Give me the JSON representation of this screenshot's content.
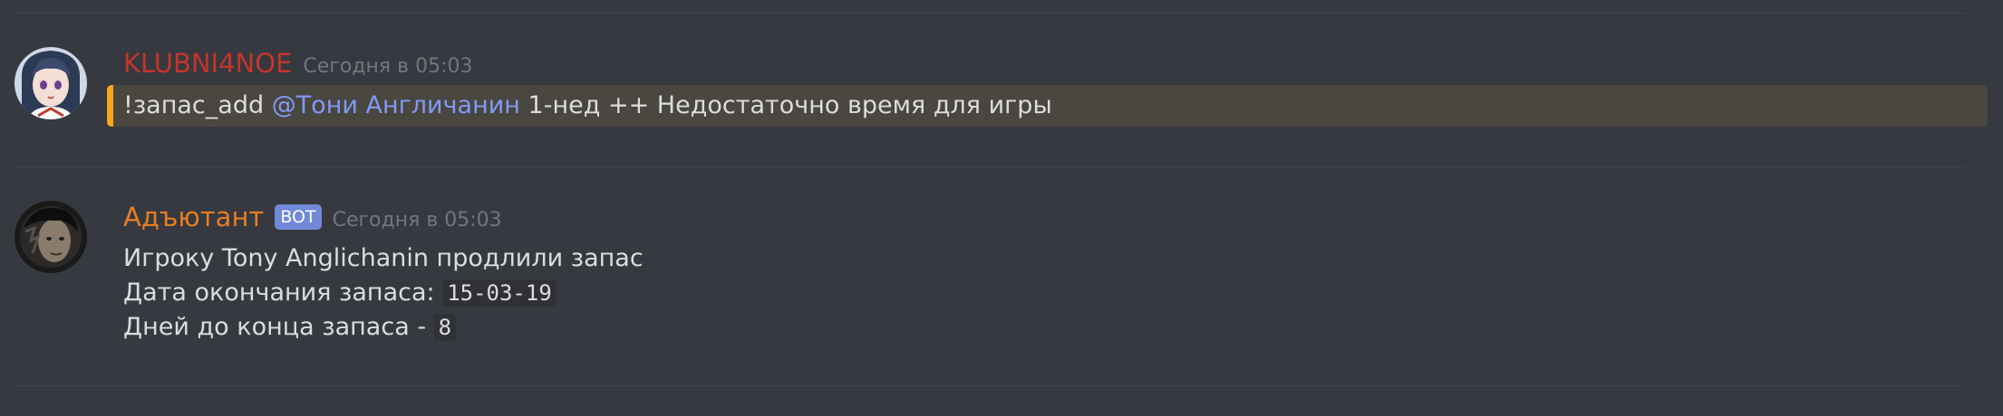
{
  "colors": {
    "background": "#36393f",
    "user1_name": "#c4352b",
    "user2_name": "#e67e22",
    "mention_text": "#7f9af5",
    "mention_bar": "#faa61a",
    "bot_badge": "#7289da"
  },
  "messages": [
    {
      "author": "KLUBNI4NOE",
      "timestamp": "Сегодня в 05:03",
      "avatar_icon": "anime-girl-avatar",
      "text_prefix": "!запас_add ",
      "mention": "@Тони Англичанин",
      "text_suffix": " 1-нед ++ Недостаточно время для игры"
    },
    {
      "author": "Адъютант",
      "badge": "BOT",
      "timestamp": "Сегодня в 05:03",
      "avatar_icon": "dark-face-avatar",
      "line1": "Игроку Tony Anglichanin продлили запас",
      "line2_label": "Дата окончания запаса: ",
      "line2_code": "15-03-19",
      "line3_label": "Дней до конца запаса - ",
      "line3_code": "8"
    }
  ]
}
